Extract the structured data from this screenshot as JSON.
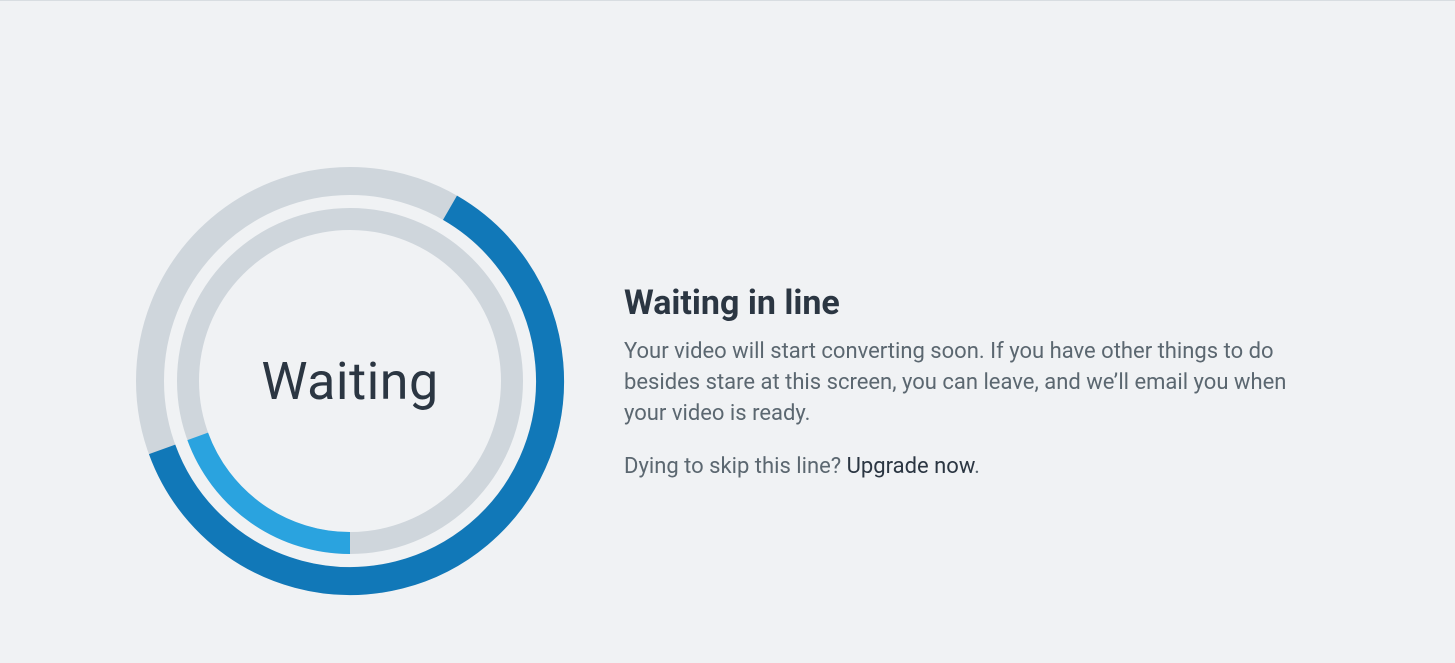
{
  "spinner": {
    "label": "Waiting",
    "track_color": "#cfd6dc",
    "outer_arc_color": "#1178b8",
    "inner_arc_color": "#2aa3df"
  },
  "heading": "Waiting in line",
  "body": "Your video will start converting soon. If you have other things to do besides stare at this screen, you can leave, and we’ll email you when your video is ready.",
  "cta_prefix": "Dying to skip this line? ",
  "cta_link_text": "Upgrade now",
  "cta_suffix": "."
}
